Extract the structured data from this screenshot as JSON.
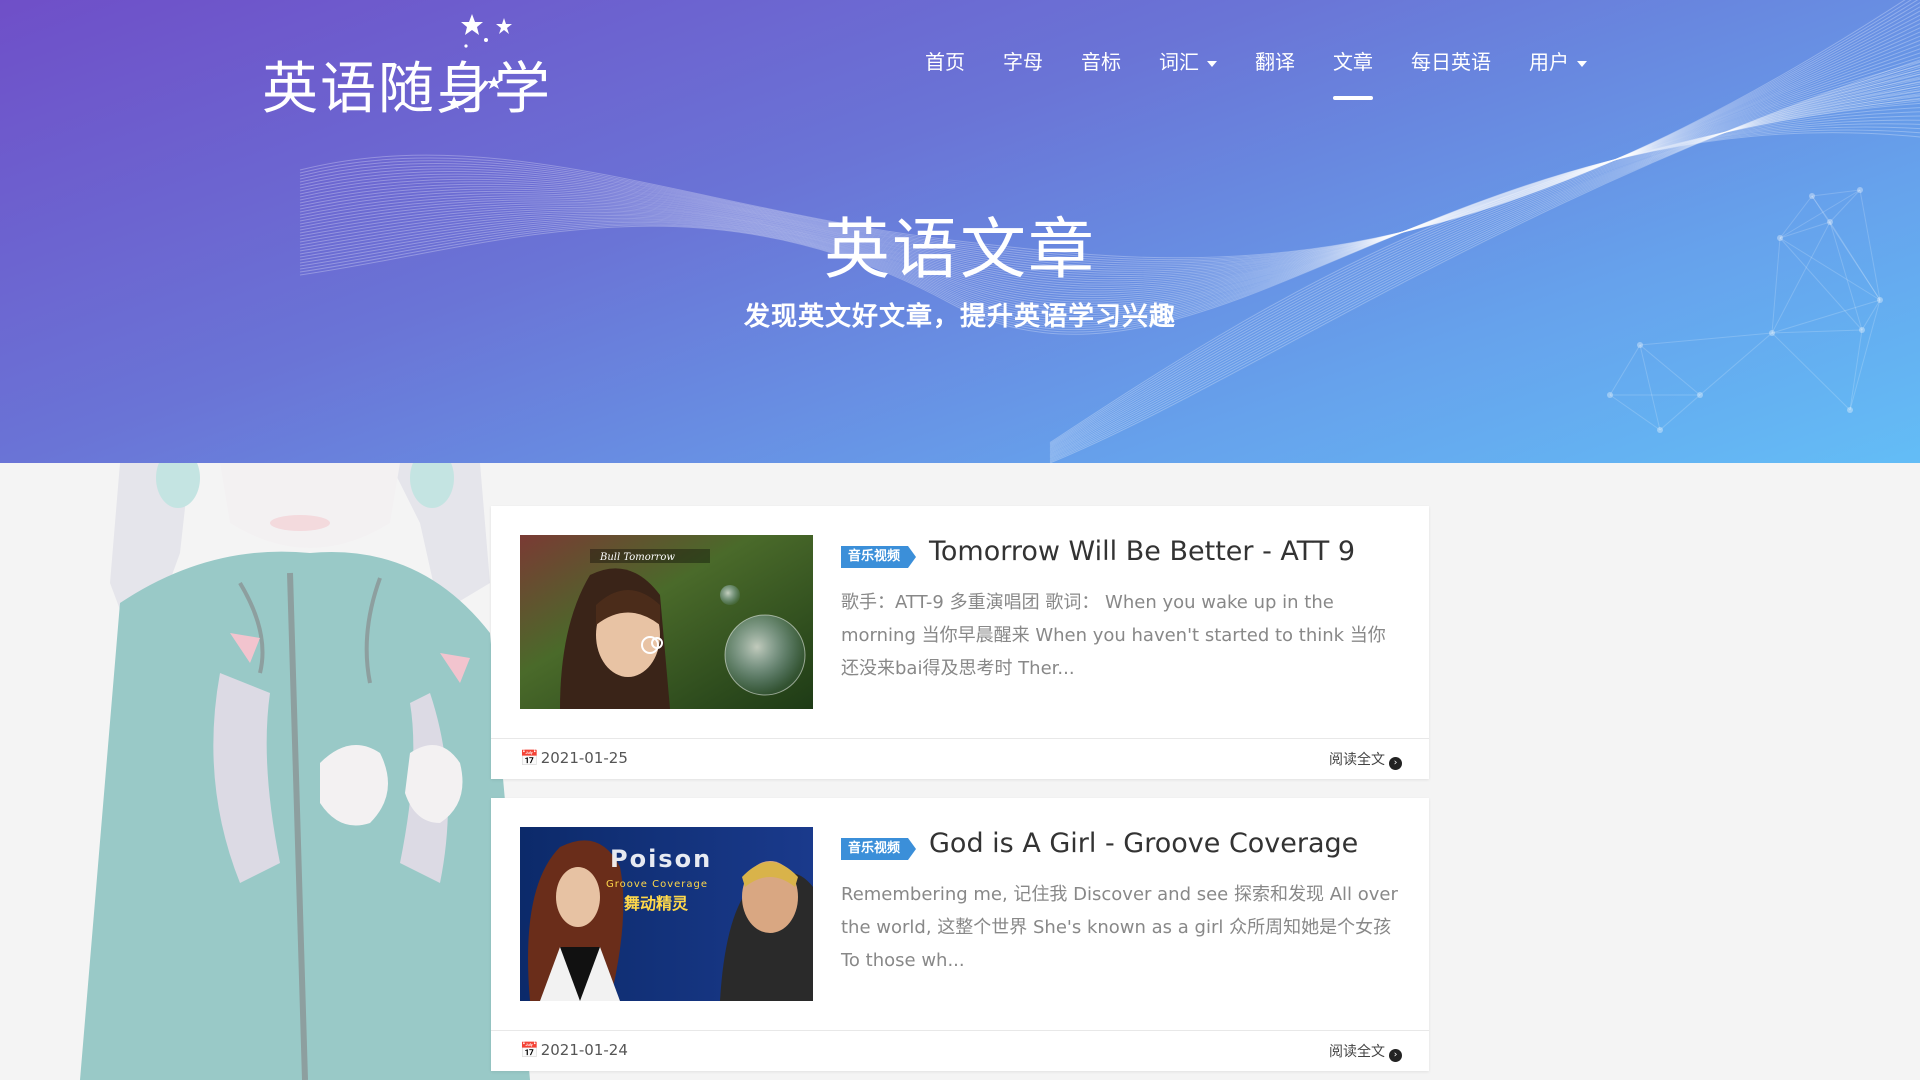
{
  "site": {
    "logo_text": "英语随身学"
  },
  "nav": {
    "items": [
      {
        "label": "首页",
        "dropdown": false,
        "active": false
      },
      {
        "label": "字母",
        "dropdown": false,
        "active": false
      },
      {
        "label": "音标",
        "dropdown": false,
        "active": false
      },
      {
        "label": "词汇",
        "dropdown": true,
        "active": false
      },
      {
        "label": "翻译",
        "dropdown": false,
        "active": false
      },
      {
        "label": "文章",
        "dropdown": false,
        "active": true
      },
      {
        "label": "每日英语",
        "dropdown": false,
        "active": false
      },
      {
        "label": "用户",
        "dropdown": true,
        "active": false
      }
    ]
  },
  "hero": {
    "title": "英语文章",
    "subtitle": "发现英文好文章，提升英语学习兴趣"
  },
  "articles": [
    {
      "tag": "音乐视频",
      "title": "Tomorrow Will Be Better - ATT 9",
      "excerpt": "歌手：ATT-9 多重演唱团 歌词： When you wake up in the morning  当你早晨醒来 When you haven't started to think  当你还没来bai得及思考时 Ther...",
      "thumb_caption": "Bull Tomorrow",
      "date": "2021-01-25",
      "read_more": "阅读全文"
    },
    {
      "tag": "音乐视频",
      "title": "God is A Girl - Groove Coverage",
      "excerpt": "Remembering me, 记住我 Discover and see 探索和发现 All over the world, 这整个世界 She's known as a girl 众所周知她是个女孩 To those wh...",
      "thumb_title": "Poison",
      "thumb_sub": "Groove Coverage",
      "thumb_cn": "舞动精灵",
      "date": "2021-01-24",
      "read_more": "阅读全文"
    }
  ],
  "colors": {
    "hero_start": "#6f4fc8",
    "hero_end": "#63bdf6",
    "tag_bg": "#3b8fd9"
  }
}
